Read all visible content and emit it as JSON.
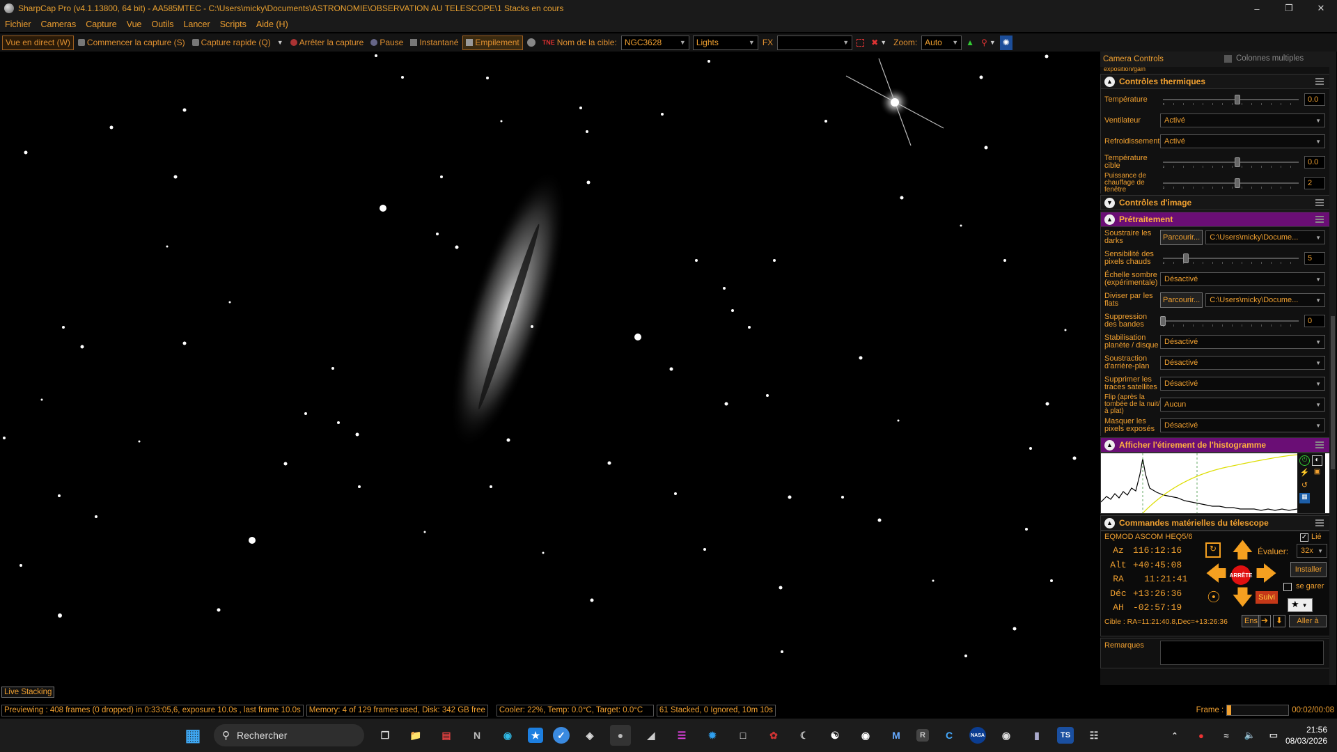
{
  "window": {
    "title": "SharpCap Pro (v4.1.13800, 64 bit) - AA585MTEC - C:\\Users\\micky\\Documents\\ASTRONOMIE\\OBSERVATION AU TELESCOPE\\1 Stacks en cours"
  },
  "menu": [
    "Fichier",
    "Cameras",
    "Capture",
    "Vue",
    "Outils",
    "Lancer",
    "Scripts",
    "Aide (H)"
  ],
  "toolbar": {
    "live_view": "Vue en direct (W)",
    "start_capture": "Commencer la capture (S)",
    "quick_capture": "Capture rapide (Q)",
    "stop_capture": "Arrêter la capture",
    "pause": "Pause",
    "snapshot": "Instantané",
    "stacking": "Empilement",
    "target_label": "Nom de la cible:",
    "target_value": "NGC3628",
    "frame_type": "Lights",
    "fx_label": "FX",
    "fx_value": "",
    "zoom_label": "Zoom:",
    "zoom_value": "Auto"
  },
  "panel": {
    "camera_controls": "Camera Controls",
    "multi_columns": "Colonnes multiples",
    "exposure_cut": "exposition/gain",
    "thermal": {
      "title": "Contrôles thermiques",
      "temperature_label": "Température",
      "temperature_value": "0.0",
      "temperature_level": 0.55,
      "fan_label": "Ventilateur",
      "fan_value": "Activé",
      "cooling_label": "Refroidissement",
      "cooling_value": "Activé",
      "target_temp_label": "Température cible",
      "target_temp_value": "0.0",
      "target_temp_level": 0.55,
      "heater_label": "Puissance de chauffage de fenêtre",
      "heater_value": "2",
      "heater_level": 0.55
    },
    "image_controls": "Contrôles d'image",
    "preprocessing": {
      "title": "Prétraitement",
      "darks_label": "Soustraire les darks",
      "browse": "Parcourir...",
      "darks_path": "C:\\Users\\micky\\Docume...",
      "hot_pixel_label": "Sensibilité des pixels chauds",
      "hot_pixel_value": "5",
      "hot_pixel_level": 0.17,
      "dark_scale_label": "Échelle sombre (expérimentale)",
      "dark_scale_value": "Désactivé",
      "flats_label": "Diviser par les flats",
      "flats_path": "C:\\Users\\micky\\Docume...",
      "banding_label": "Suppression des bandes",
      "banding_value": "0",
      "banding_level": 0,
      "stabilization_label": "Stabilisation planète / disque",
      "stabilization_value": "Désactivé",
      "background_label": "Soustraction d'arrière-plan",
      "background_value": "Désactivé",
      "satellite_label": "Supprimer les traces satellites",
      "satellite_value": "Désactivé",
      "flip_label": "Flip (après la tombée de la nuit/à plat)",
      "flip_value": "Aucun",
      "mask_label": "Masquer les pixels exposés",
      "mask_value": "Désactivé"
    },
    "histogram_title": "Afficher l'étirement de l'histogramme",
    "telescope": {
      "title": "Commandes matérielles du télescope",
      "mount": "EQMOD ASCOM HEQ5/6",
      "linked": "Lié",
      "az_label": "Az",
      "az": "116:12:16",
      "alt_label": "Alt",
      "alt": "+40:45:08",
      "ra_label": "RA",
      "ra": "11:21:41",
      "dec_label": "Déc",
      "dec": "+13:26:36",
      "ah_label": "AH",
      "ah": "-02:57:19",
      "rate_label": "Évaluer:",
      "rate_value": "32x",
      "install": "Installer",
      "park": "se garer",
      "stop": "ARRÊTE",
      "track": "Suivi",
      "target": "Cible : RA=11:21:40.8,Dec=+13:26:36",
      "ens": "Ens",
      "goto": "Aller à"
    },
    "notes_label": "Remarques"
  },
  "live_stacking_tab": "Live Stacking",
  "status": {
    "preview": "Previewing : 408 frames (0 dropped) in 0:33:05,6, exposure 10.0s , last frame 10.0s",
    "memory": "Memory: 4 of 129 frames used, Disk: 342 GB free",
    "cooler": "Cooler: 22%, Temp: 0.0°C, Target: 0.0°C",
    "stacked": "61 Stacked, 0 Ignored, 10m 10s",
    "frame_label": "Frame :",
    "frame_count": "00:02/00:08",
    "frame_level": 0.06
  },
  "taskbar": {
    "search": "Rechercher",
    "time": "21:56",
    "date": "08/03/2026"
  },
  "colors": {
    "accent": "#f0a030",
    "purple": "#6a0e75",
    "stop_red": "#e01010"
  }
}
